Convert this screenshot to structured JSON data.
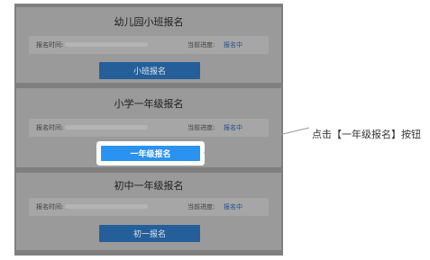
{
  "cards": [
    {
      "title": "幼儿园小班报名",
      "time_label": "报名时间:",
      "status_label": "当前进度:",
      "status_value": "报名中",
      "button": "小班报名"
    },
    {
      "title": "小学一年级报名",
      "time_label": "报名时间:",
      "status_label": "当前进度:",
      "status_value": "报名中",
      "button": "一年级报名"
    },
    {
      "title": "初中一年级报名",
      "time_label": "报名时间:",
      "status_label": "当前进度:",
      "status_value": "报名中",
      "button": "初一报名"
    }
  ],
  "annotation": {
    "text": "点击【一年级报名】按钮"
  },
  "colors": {
    "overlay": "#7f7f7f",
    "highlight_button": "#2a92f0",
    "dimmed_button": "#245f9a"
  }
}
